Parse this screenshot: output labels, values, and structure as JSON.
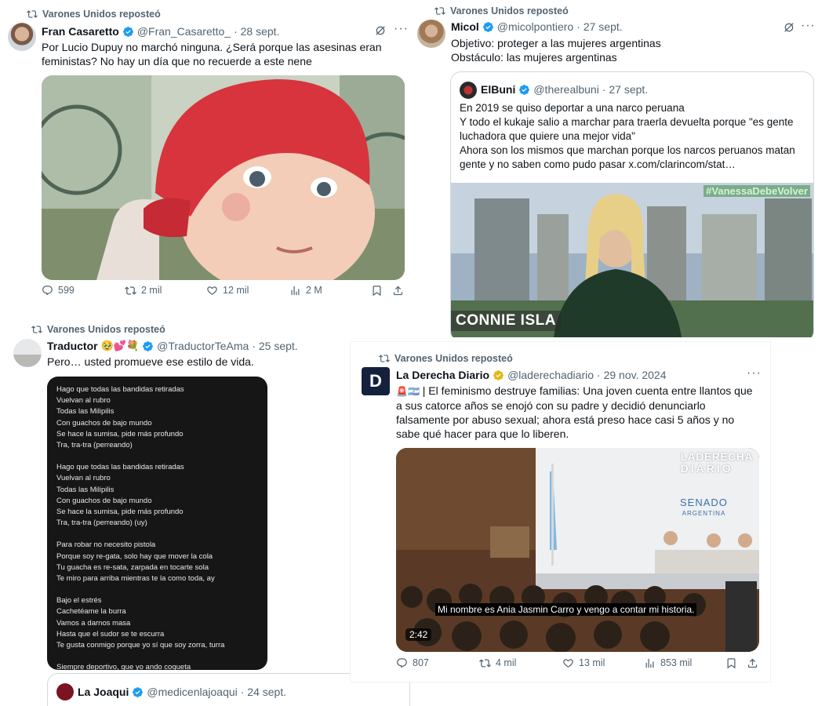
{
  "tweet1": {
    "retweet_label": "Varones Unidos reposteó",
    "name": "Fran Casaretto",
    "handle": "@Fran_Casaretto_",
    "date": "· 28 sept.",
    "text": "Por Lucio Dupuy no marchó ninguna. ¿Será porque las asesinas eran feministas? No hay un día que no recuerde a este nene",
    "replies": "599",
    "retweets": "2 mil",
    "likes": "12 mil",
    "views": "2 M"
  },
  "tweet2": {
    "retweet_label": "Varones Unidos reposteó",
    "name": "Micol",
    "handle": "@micolpontiero",
    "date": "· 27 sept.",
    "line1": "Objetivo: proteger a las mujeres argentinas",
    "line2": "Obstáculo: las mujeres argentinas",
    "quote": {
      "name": "ElBuni",
      "handle": "@therealbuni",
      "date": "· 27 sept.",
      "line1": "En 2019 se quiso deportar a una narco peruana",
      "line2": "Y todo el kukaje salio a marchar para traerla devuelta porque \"es gente luchadora que quiere una mejor vida\"",
      "line3": "Ahora son los mismos que marchan porque los narcos peruanos matan gente y no saben como pudo pasar  x.com/clarincom/stat…",
      "video_hashtag": "#VanessaDebeVolver",
      "video_caption": "CONNIE ISLA"
    }
  },
  "tweet3": {
    "retweet_label": "Varones Unidos reposteó",
    "name": "Traductor",
    "name_emojis": "🥹💕💐",
    "handle": "@TraductorTeAma",
    "date": "· 25 sept.",
    "text": "Pero… usted promueve ese estilo de vida.",
    "lyrics": [
      [
        "Hago que todas las bandidas retiradas",
        "Vuelvan al rubro",
        "Todas las Milipilis",
        "Con guachos de bajo mundo",
        "Se hace la sumisa, pide más profundo",
        "Tra, tra-tra (perreando)"
      ],
      [
        "Hago que todas las bandidas retiradas",
        "Vuelvan al rubro",
        "Todas las Milipilis",
        "Con guachos de bajo mundo",
        "Se hace la sumisa, pide más profundo",
        "Tra, tra-tra (perreando) (uy)"
      ],
      [
        "Para robar no necesito pistola",
        "Porque soy re-gata, solo hay que mover la cola",
        "Tu guacha es re-sata, zarpada en tocarte sola",
        "Te miro para arriba mientras te la como toda, ay"
      ],
      [
        "Bajo el estrés",
        "Cachetéame la burra",
        "Vamos a darnos masa",
        "Hasta que el sudor se te escurra",
        "Te gusta conmigo porque yo sí que soy zorra, turra"
      ],
      [
        "Siempre deportivo, que yo ando coqueta"
      ]
    ],
    "quote": {
      "name": "La Joaqui",
      "handle": "@medicenlajoaqui",
      "date": "· 24 sept."
    }
  },
  "tweet4": {
    "retweet_label": "Varones Unidos reposteó",
    "name": "La Derecha Diario",
    "handle": "@laderechadiario",
    "date": "· 29 nov. 2024",
    "flags": "🚨🇦🇷",
    "text": "| El feminismo destruye familias: Una joven cuenta entre llantos que a sus catorce años se enojó con su padre y decidió denunciarlo falsamente por abuso sexual; ahora está preso hace casi 5 años y no sabe qué hacer para que lo liberen.",
    "video_logo_line1": "LADERECHA",
    "video_logo_line2": "DIARIO",
    "senado_line1": "SENADO",
    "senado_line2": "ARGENTINA",
    "subtitle": "Mi nombre es Ania Jasmin Carro y vengo a contar mi historia.",
    "duration": "2:42",
    "replies": "807",
    "retweets": "4 mil",
    "likes": "13 mil",
    "views": "853 mil"
  },
  "colors": {
    "verified_blue": "#1d9bf0",
    "verified_gold": "#e2b719",
    "text_secondary": "#536471"
  }
}
